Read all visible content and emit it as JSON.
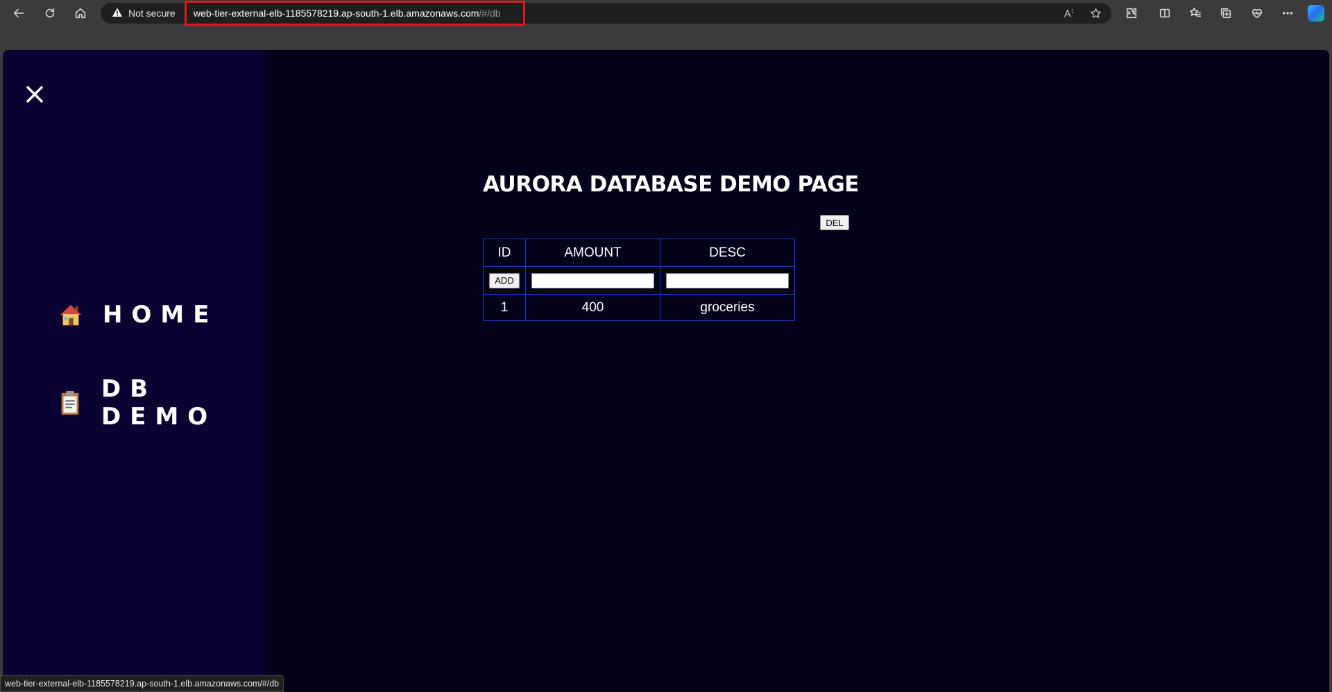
{
  "browser": {
    "security_label": "Not secure",
    "url_host": "web-tier-external-elb-1185578219.ap-south-1.elb.amazonaws.com",
    "url_path": "/#/db",
    "status_url": "web-tier-external-elb-1185578219.ap-south-1.elb.amazonaws.com/#/db"
  },
  "sidebar": {
    "items": [
      {
        "label": "HOME",
        "icon": "house-icon"
      },
      {
        "label": "DB DEMO",
        "icon": "clipboard-icon"
      }
    ]
  },
  "main": {
    "title": "AURORA DATABASE DEMO PAGE",
    "del_label": "DEL",
    "add_label": "ADD",
    "table": {
      "headers": [
        "ID",
        "AMOUNT",
        "DESC"
      ],
      "rows": [
        [
          "1",
          "400",
          "groceries"
        ]
      ]
    }
  },
  "colors": {
    "page_bg": "#03021a",
    "sidebar_bg": "#0b0232",
    "table_border": "#1c3bd8",
    "url_highlight": "#e0171f"
  }
}
